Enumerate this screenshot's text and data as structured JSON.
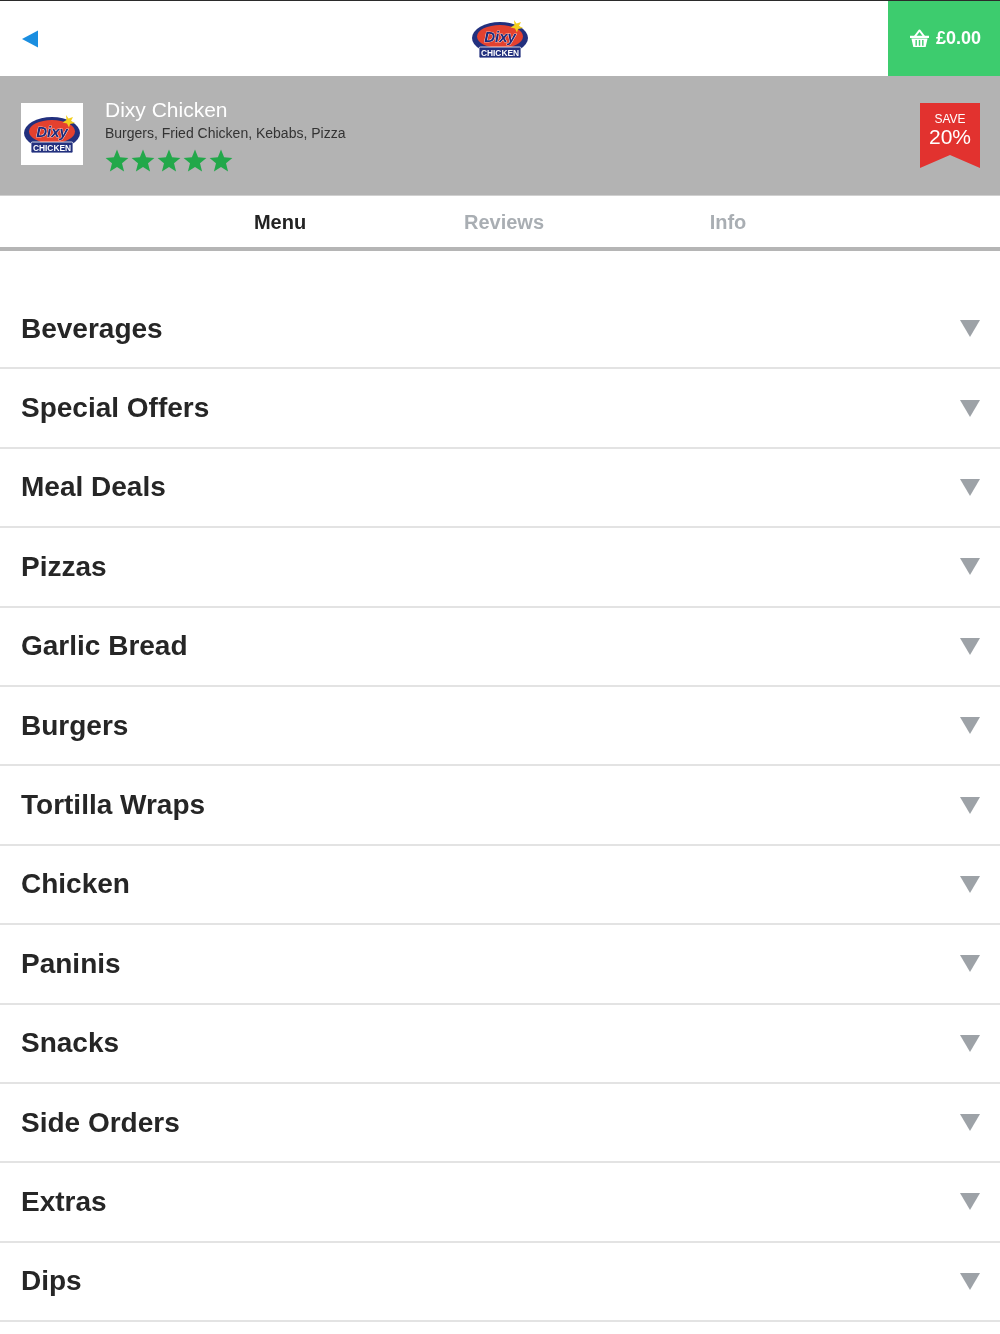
{
  "top_bar": {
    "logo": {
      "text": "Dixy",
      "subtext": "CHICKEN"
    },
    "cart": {
      "total": "£0.00"
    }
  },
  "restaurant": {
    "logo": {
      "text": "Dixy",
      "subtext": "CHICKEN"
    },
    "name": "Dixy Chicken",
    "cuisines": "Burgers, Fried Chicken, Kebabs, Pizza",
    "stars": 5,
    "offer": {
      "label": "SAVE",
      "value": "20%"
    }
  },
  "tabs": [
    {
      "label": "Menu",
      "selected": true
    },
    {
      "label": "Reviews",
      "selected": false
    },
    {
      "label": "Info",
      "selected": false
    }
  ],
  "categories": [
    {
      "name": "Beverages",
      "expanded": false
    },
    {
      "name": "Special Offers",
      "expanded": false
    },
    {
      "name": "Meal Deals",
      "expanded": false
    },
    {
      "name": "Pizzas",
      "expanded": false
    },
    {
      "name": "Garlic Bread",
      "expanded": false
    },
    {
      "name": "Burgers",
      "expanded": false
    },
    {
      "name": "Tortilla Wraps",
      "expanded": false
    },
    {
      "name": "Chicken",
      "expanded": false
    },
    {
      "name": "Paninis",
      "expanded": false
    },
    {
      "name": "Snacks",
      "expanded": false
    },
    {
      "name": "Side Orders",
      "expanded": false
    },
    {
      "name": "Extras",
      "expanded": false
    },
    {
      "name": "Dips",
      "expanded": false
    }
  ]
}
